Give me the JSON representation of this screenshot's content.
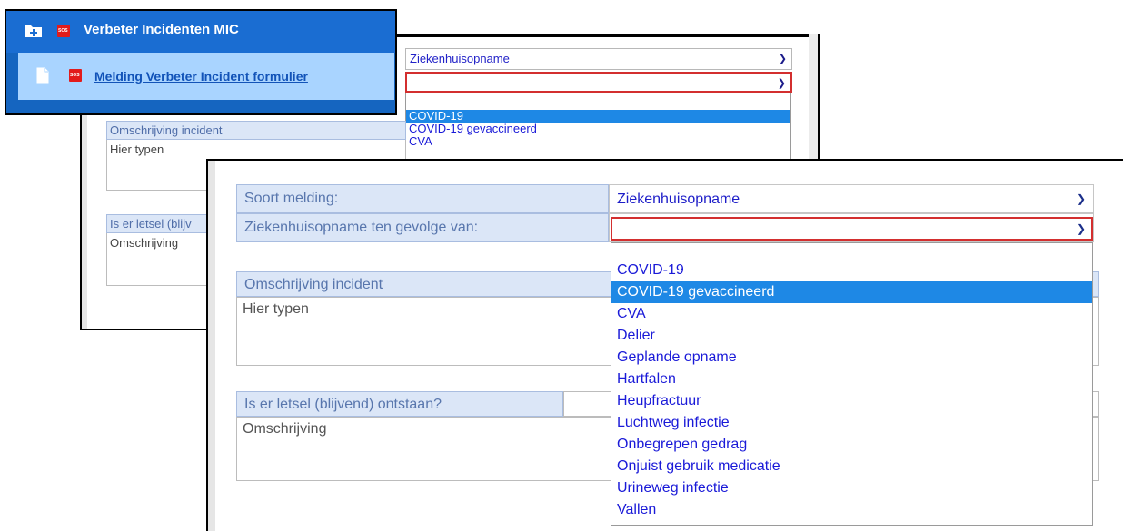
{
  "nav": {
    "title": "Verbeter Incidenten MIC",
    "link": "Melding Verbeter Incident formulier"
  },
  "back_form": {
    "soort_value": "Ziekenhuisopname",
    "options": [
      "COVID-19",
      "COVID-19 gevaccineerd",
      "CVA"
    ],
    "selected_option": "COVID-19",
    "omschrijving_header": "Omschrijving incident",
    "omschrijving_placeholder": "Hier typen",
    "letsel_header": "Is er letsel (blijv",
    "letsel_placeholder": "Omschrijving"
  },
  "form": {
    "soort_label": "Soort melding:",
    "soort_value": "Ziekenhuisopname",
    "gevolge_label": "Ziekenhuisopname ten gevolge van:",
    "gevolge_value": "",
    "omschrijving_header": "Omschrijving incident",
    "omschrijving_placeholder": "Hier typen",
    "letsel_header": "Is er letsel (blijvend) ontstaan?",
    "letsel_placeholder": "Omschrijving",
    "selected_option": "COVID-19 gevaccineerd",
    "options": [
      "COVID-19",
      "COVID-19 gevaccineerd",
      "CVA",
      "Delier",
      "Geplande opname",
      "Hartfalen",
      "Heupfractuur",
      "Luchtweg infectie",
      "Onbegrepen gedrag",
      "Onjuist gebruik medicatie",
      "Urineweg infectie",
      "Vallen"
    ]
  },
  "colors": {
    "nav_blue": "#1565c0",
    "nav_sub": "#a9d4ff",
    "header_bg": "#dbe6f7",
    "option_text": "#1a1ad8",
    "selected_bg": "#1e88e5",
    "invalid_border": "#d32f2f"
  },
  "icons": {
    "folder": "folder-plus-icon",
    "doc": "document-icon",
    "sos": "sos-icon",
    "chevron": "chevron-down-icon"
  }
}
